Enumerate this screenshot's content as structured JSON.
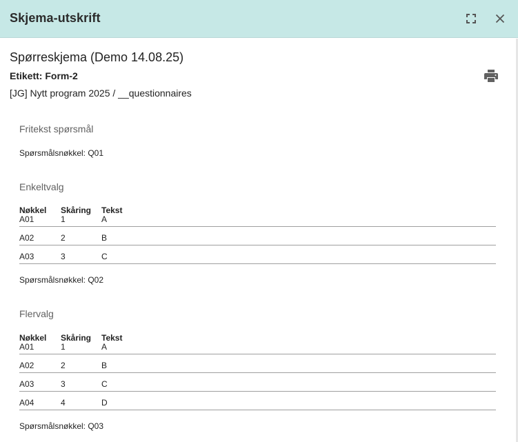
{
  "dialog": {
    "title": "Skjema-utskrift",
    "header_bg": "#c6e8e6"
  },
  "document": {
    "title": "Spørreskjema (Demo 14.08.25)",
    "label": "Etikett: Form-2",
    "path": "[JG] Nytt program 2025 / __questionnaires"
  },
  "table_headers": {
    "key": "Nøkkel",
    "score": "Skåring",
    "text": "Tekst"
  },
  "questions": [
    {
      "title": "Fritekst spørsmål",
      "key_line": "Spørsmålsnøkkel: Q01",
      "options": []
    },
    {
      "title": "Enkeltvalg",
      "key_line": "Spørsmålsnøkkel: Q02",
      "options": [
        {
          "key": "A01",
          "score": "1",
          "text": "A"
        },
        {
          "key": "A02",
          "score": "2",
          "text": "B"
        },
        {
          "key": "A03",
          "score": "3",
          "text": "C"
        }
      ]
    },
    {
      "title": "Flervalg",
      "key_line": "Spørsmålsnøkkel: Q03",
      "options": [
        {
          "key": "A01",
          "score": "1",
          "text": "A"
        },
        {
          "key": "A02",
          "score": "2",
          "text": "B"
        },
        {
          "key": "A03",
          "score": "3",
          "text": "C"
        },
        {
          "key": "A04",
          "score": "4",
          "text": "D"
        }
      ]
    }
  ],
  "icons": {
    "fullscreen": "fullscreen-icon",
    "close": "close-icon",
    "print": "print-icon"
  }
}
